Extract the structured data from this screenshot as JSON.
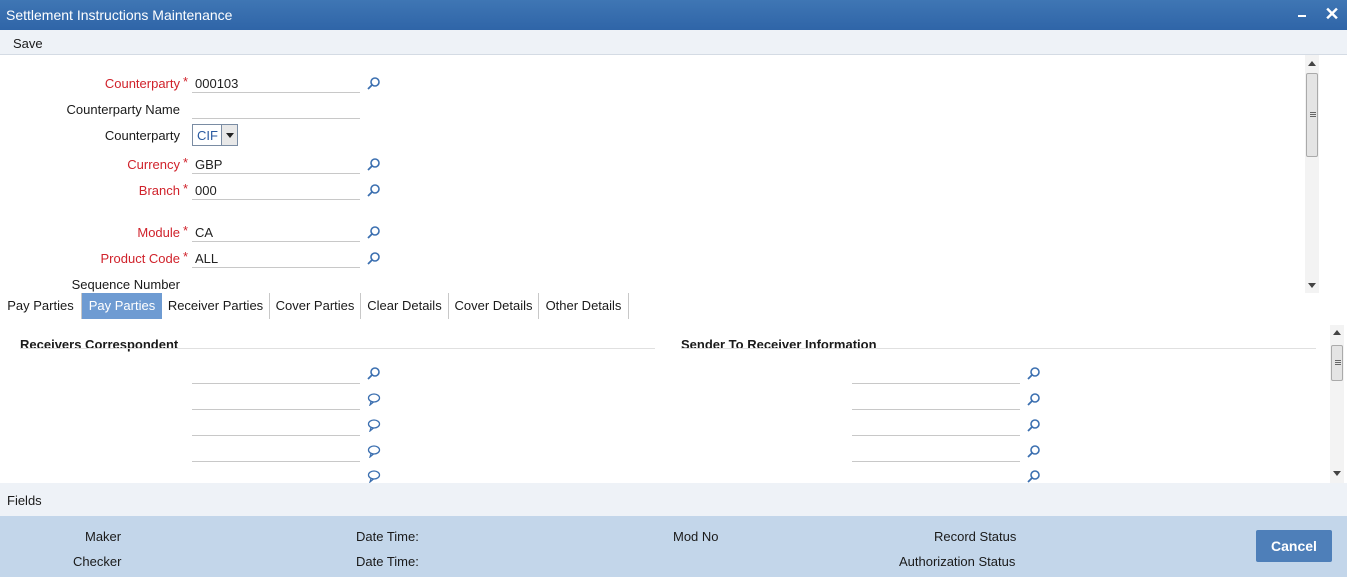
{
  "window": {
    "title": "Settlement Instructions Maintenance"
  },
  "toolbar": {
    "save_label": "Save"
  },
  "header": {
    "counterparty": {
      "label": "Counterparty",
      "value": "000103"
    },
    "counterparty_name": {
      "label": "Counterparty Name",
      "value": ""
    },
    "counterparty_type": {
      "label": "Counterparty",
      "value": "CIF"
    },
    "currency": {
      "label": "Currency",
      "value": "GBP"
    },
    "branch": {
      "label": "Branch",
      "value": "000"
    },
    "module": {
      "label": "Module",
      "value": "CA"
    },
    "product_code": {
      "label": "Product Code",
      "value": "ALL"
    },
    "sequence_number": {
      "label": "Sequence Number",
      "value": ""
    },
    "required_mark": "*"
  },
  "tabs": [
    {
      "label": "Pay Parties",
      "active": false
    },
    {
      "label": "Pay Parties",
      "active": true
    },
    {
      "label": "Receiver Parties",
      "active": false
    },
    {
      "label": "Cover Parties",
      "active": false
    },
    {
      "label": "Clear Details",
      "active": false
    },
    {
      "label": "Cover Details",
      "active": false
    },
    {
      "label": "Other Details",
      "active": false
    }
  ],
  "sections": {
    "receivers_correspondent": "Receivers Correspondent",
    "sender_to_receiver": "Sender To Receiver Information"
  },
  "fields_bar": {
    "label": "Fields"
  },
  "footer": {
    "maker": "Maker",
    "checker": "Checker",
    "date_time_1": "Date Time:",
    "date_time_2": "Date Time:",
    "mod_no": "Mod No",
    "record_status": "Record Status",
    "authorization_status": "Authorization Status",
    "cancel_label": "Cancel"
  },
  "colors": {
    "title_bar": "#2f65a8",
    "required": "#d0222b",
    "active_tab": "#6e9bd2",
    "footer": "#c3d6ea",
    "button": "#4e7fb9"
  }
}
